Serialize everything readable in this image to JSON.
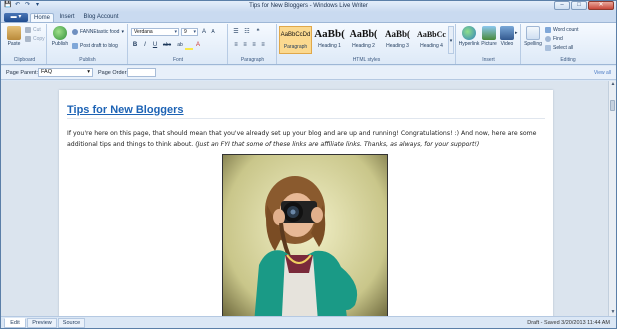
{
  "window": {
    "title": "Tips for New Bloggers - Windows Live Writer",
    "minimize_label": "–",
    "maximize_label": "□",
    "close_label": "✕"
  },
  "qat": {
    "save_glyph": "💾",
    "undo_glyph": "↶",
    "redo_glyph": "↷",
    "more_glyph": "▾"
  },
  "ribbon": {
    "app_button": "▬ ▾",
    "tabs": [
      {
        "label": "Home",
        "active": true
      },
      {
        "label": "Insert",
        "active": false
      },
      {
        "label": "Blog Account",
        "active": false
      }
    ],
    "clipboard": {
      "label": "Clipboard",
      "paste": "Paste",
      "cut": "Cut",
      "copy": "Copy"
    },
    "publish": {
      "label": "Publish",
      "publish_button": "Publish",
      "blog_selector": "FANNEtastic food",
      "post_draft": "Post draft to blog"
    },
    "font": {
      "label": "Font",
      "font_family": "Verdana",
      "font_size": "9",
      "bold": "B",
      "italic": "I",
      "underline": "U",
      "strikethrough": "abc",
      "highlight": "ab",
      "font_color": "A"
    },
    "paragraph": {
      "label": "Paragraph"
    },
    "styles": {
      "label": "HTML styles",
      "items": [
        {
          "sample": "AaBbCcDd",
          "name": "Paragraph",
          "selected": true,
          "size": "6px"
        },
        {
          "sample": "AaBb(",
          "name": "Heading 1",
          "selected": false,
          "size": "11px"
        },
        {
          "sample": "AaBb(",
          "name": "Heading 2",
          "selected": false,
          "size": "10px"
        },
        {
          "sample": "AaBb(",
          "name": "Heading 3",
          "selected": false,
          "size": "9px"
        },
        {
          "sample": "AaBbCc",
          "name": "Heading 4",
          "selected": false,
          "size": "8px"
        }
      ]
    },
    "insert": {
      "label": "Insert",
      "hyperlink": "Hyperlink",
      "picture": "Picture",
      "video": "Video"
    },
    "editing": {
      "label": "Editing",
      "spelling": "Spelling",
      "word_count": "Word count",
      "find": "Find",
      "select_all": "Select all"
    }
  },
  "properties": {
    "page_parent_label": "Page Parent:",
    "page_parent_value": "FAQ",
    "page_order_label": "Page Order:",
    "page_order_value": "",
    "view_all": "View all"
  },
  "post": {
    "title": "Tips for New Bloggers",
    "paragraph_main": "If you're here on this page, that should mean that you've already set up your blog and are up and running! Congratulations! :) And now, here are some additional tips and things to think about. ",
    "paragraph_italic": "(Just an FYI that some of these links are affiliate links. Thanks, as always, for your support!)"
  },
  "view_tabs": [
    {
      "label": "Edit",
      "active": true
    },
    {
      "label": "Preview",
      "active": false
    },
    {
      "label": "Source",
      "active": false
    }
  ],
  "status": "Draft - Saved 3/20/2013 11:44 AM",
  "colors": {
    "title_link": "#1d63b5",
    "selected_style": "#fbd98f",
    "close_button": "#c9483a"
  }
}
